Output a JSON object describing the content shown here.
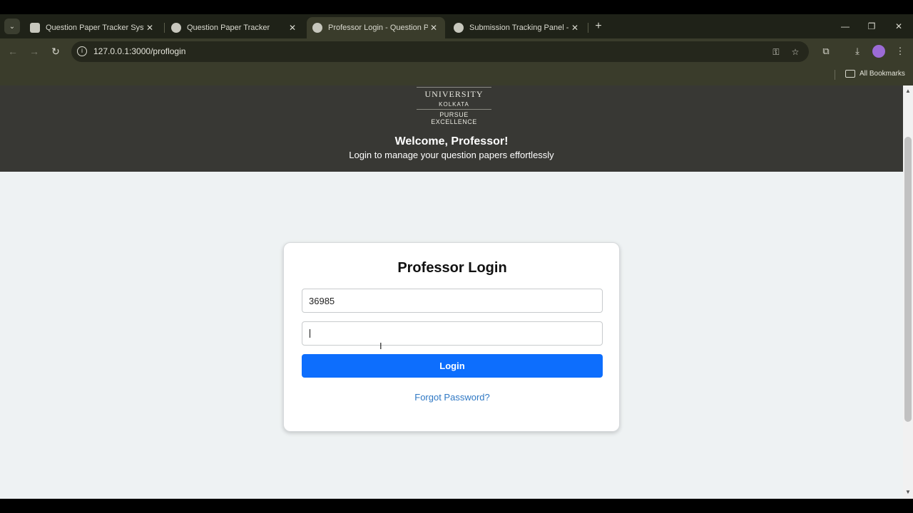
{
  "browser": {
    "tabs": [
      {
        "title": "Question Paper Tracker System",
        "active": false
      },
      {
        "title": "Question Paper Tracker",
        "active": false
      },
      {
        "title": "Professor Login - Question Paper Tracker",
        "active": true
      },
      {
        "title": "Submission Tracking Panel - Question Paper Tracker",
        "active": false
      }
    ],
    "url": "127.0.0.1:3000/proflogin",
    "bookmarks_label": "All Bookmarks",
    "icons": {
      "tab_search": "chevron-down-icon",
      "new_tab": "plus-icon",
      "minimize": "minimize-icon",
      "restore": "restore-icon",
      "close": "close-icon",
      "back": "arrow-left-icon",
      "forward": "arrow-right-icon",
      "reload": "reload-icon",
      "site_info": "info-icon",
      "password": "key-icon",
      "bookmark": "star-icon",
      "extensions": "puzzle-icon",
      "downloads": "download-icon",
      "menu": "kebab-menu-icon",
      "folder": "folder-icon"
    },
    "glyphs": {
      "tab_search": "⌄",
      "close": "✕",
      "new_tab": "+",
      "minimize": "—",
      "restore": "❐",
      "back": "←",
      "forward": "→",
      "reload": "↻",
      "info": "i",
      "password": "⚿",
      "bookmark": "☆",
      "extensions": "⧉",
      "downloads": "⤓",
      "menu": "⋮",
      "scroll_up": "▲",
      "scroll_down": "▼",
      "ibeam": "I"
    }
  },
  "header": {
    "logo": {
      "line1": "UNIVERSITY",
      "line2": "KOLKATA",
      "line3": "PURSUE EXCELLENCE"
    },
    "welcome": "Welcome, Professor!",
    "subtitle": "Login to manage your question papers effortlessly"
  },
  "login": {
    "title": "Professor Login",
    "username_value": "36985",
    "password_value": "",
    "button_label": "Login",
    "forgot_label": "Forgot Password?"
  },
  "colors": {
    "header_bg": "#383834",
    "page_bg": "#eef2f3",
    "button_bg": "#0d6efd",
    "link": "#2f78c4",
    "browser_chrome": "#3a3c2b"
  }
}
